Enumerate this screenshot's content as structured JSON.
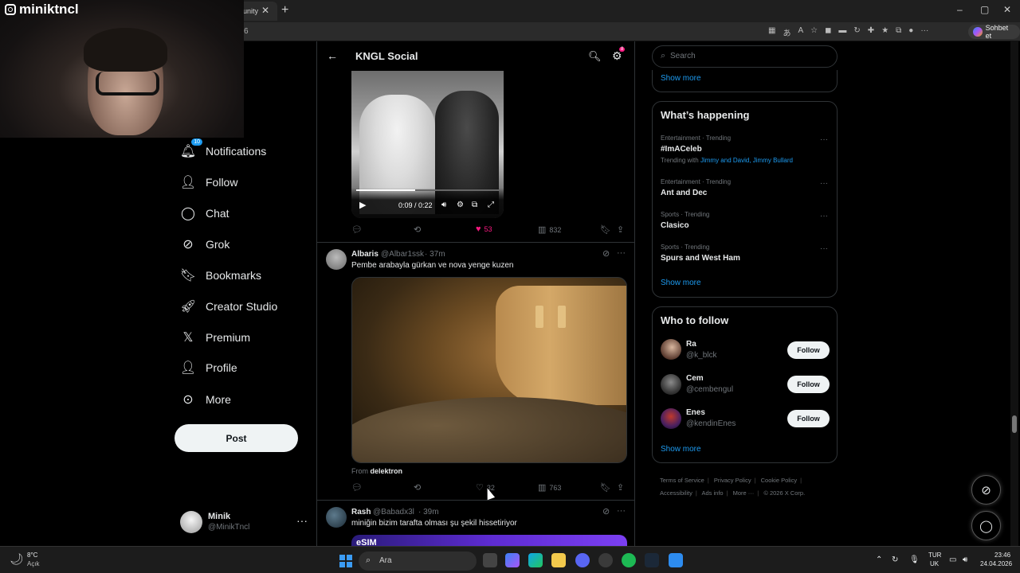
{
  "browser": {
    "tab_label": "unity",
    "address_fragment": "6",
    "sohbet_label": "Sohbet et",
    "window_controls": [
      "–",
      "▢",
      "✕"
    ]
  },
  "webcam": {
    "streamer_name": "miniktncl",
    "icon": "instagram-icon"
  },
  "nav": {
    "items": [
      {
        "label": "Notifications",
        "icon": "bell-icon",
        "badge": "10"
      },
      {
        "label": "Follow",
        "icon": "person-plus-icon"
      },
      {
        "label": "Chat",
        "icon": "chat-bubble-icon"
      },
      {
        "label": "Grok",
        "icon": "grok-icon"
      },
      {
        "label": "Bookmarks",
        "icon": "bookmark-icon"
      },
      {
        "label": "Creator Studio",
        "icon": "rocket-icon"
      },
      {
        "label": "Premium",
        "icon": "x-logo-icon"
      },
      {
        "label": "Profile",
        "icon": "person-icon"
      },
      {
        "label": "More",
        "icon": "more-circle-icon"
      }
    ],
    "post_label": "Post",
    "account": {
      "name": "Minik",
      "handle": "@MinikTncl"
    }
  },
  "timeline": {
    "title": "KNGL Social",
    "settings_badge": "8",
    "video1": {
      "time": "0:09 / 0:22",
      "progress": 0.41
    },
    "post1_stats": {
      "likes": "53",
      "views": "832"
    },
    "post2": {
      "name": "Albaris",
      "handle": "@Albar1ssk",
      "time": "· 37m",
      "text": "Pembe arabayla gürkan ve nova yenge kuzen",
      "from_prefix": "From",
      "from_user": "delektron",
      "likes": "32",
      "views": "763"
    },
    "post3": {
      "name": "Rash",
      "handle": "@Babadx3l",
      "time": "· 39m",
      "text": "miniğin bizim tarafta olması şu şekil hissetiriyor",
      "media_label": "eSIM"
    }
  },
  "sidebar": {
    "search_placeholder": "Search",
    "show_more": "Show more",
    "whats_happening": {
      "title": "What’s happening",
      "trends": [
        {
          "category": "Entertainment · Trending",
          "name": "#ImACeleb",
          "with_prefix": "Trending with",
          "with": "Jimmy and David, Jimmy Bullard"
        },
        {
          "category": "Entertainment · Trending",
          "name": "Ant and Dec"
        },
        {
          "category": "Sports · Trending",
          "name": "Clasico"
        },
        {
          "category": "Sports · Trending",
          "name": "Spurs and West Ham"
        }
      ]
    },
    "who_to_follow": {
      "title": "Who to follow",
      "follow_label": "Follow",
      "users": [
        {
          "name": "Ra",
          "handle": "@k_blck"
        },
        {
          "name": "Cem",
          "handle": "@cembengul"
        },
        {
          "name": "Enes",
          "handle": "@kendinEnes"
        }
      ]
    },
    "footer": [
      "Terms of Service",
      "Privacy Policy",
      "Cookie Policy",
      "Accessibility",
      "Ads info",
      "More ···",
      "© 2026 X Corp."
    ]
  },
  "taskbar": {
    "weather_temp": "8°C",
    "weather_cond": "Açık",
    "search_label": "Ara",
    "lang_top": "TUR",
    "lang_bottom": "UK",
    "time": "23:46",
    "date": "24.04.2026"
  },
  "colors": {
    "accent": "#1d9bf0",
    "like": "#f91880",
    "background": "#000000"
  }
}
